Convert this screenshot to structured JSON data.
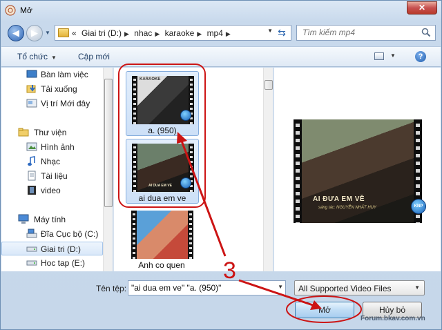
{
  "window": {
    "title": "Mở",
    "close_label": "✕"
  },
  "address": {
    "crumbs": [
      "«",
      "Giai tri (D:)",
      "nhac",
      "karaoke",
      "mp4"
    ],
    "search_placeholder": "Tìm kiếm mp4"
  },
  "toolbar": {
    "organize_label": "Tổ chức",
    "new_folder_label": "Cập mới",
    "help_label": "?"
  },
  "nav": {
    "items": [
      {
        "label": "Bàn làm việc",
        "icon": "desktop-icon"
      },
      {
        "label": "Tải xuống",
        "icon": "downloads-icon"
      },
      {
        "label": "Vị trí Mới đây",
        "icon": "recent-places-icon"
      },
      {
        "label": "Thư viện",
        "icon": "libraries-icon"
      },
      {
        "label": "Hình ảnh",
        "icon": "pictures-icon"
      },
      {
        "label": "Nhạc",
        "icon": "music-icon"
      },
      {
        "label": "Tài liệu",
        "icon": "documents-icon"
      },
      {
        "label": "video",
        "icon": "video-icon"
      },
      {
        "label": "Máy tính",
        "icon": "computer-icon"
      },
      {
        "label": "Đĩa Cục bộ (C:)",
        "icon": "local-disk-icon"
      },
      {
        "label": "Giai tri (D:)",
        "icon": "drive-icon"
      },
      {
        "label": "Hoc tap (E:)",
        "icon": "drive-icon"
      }
    ],
    "selected": "Giai tri (D:)"
  },
  "files": [
    {
      "name": "a. (950)",
      "selected": true,
      "thumb_caption": "KARAOKE"
    },
    {
      "name": "ai dua em ve",
      "selected": true,
      "thumb_caption": "AI DUA EM VE"
    },
    {
      "name": "Anh co quen",
      "selected": false,
      "thumb_caption": ""
    }
  ],
  "preview": {
    "title": "AI ĐƯA EM VỀ",
    "subtitle": "sáng tác: NGUYỄN NHẤT HUY",
    "badge": "KNP"
  },
  "bottom": {
    "filename_label": "Tên tệp:",
    "filename_value": "\"ai dua em ve\" \"a. (950)\"",
    "filter_value": "All Supported Video Files",
    "open_label": "Mở",
    "cancel_label": "Hủy bỏ",
    "watermark": "Forum.bkav.com.vn"
  },
  "annotation": {
    "step": "3",
    "color": "#cc1414"
  }
}
